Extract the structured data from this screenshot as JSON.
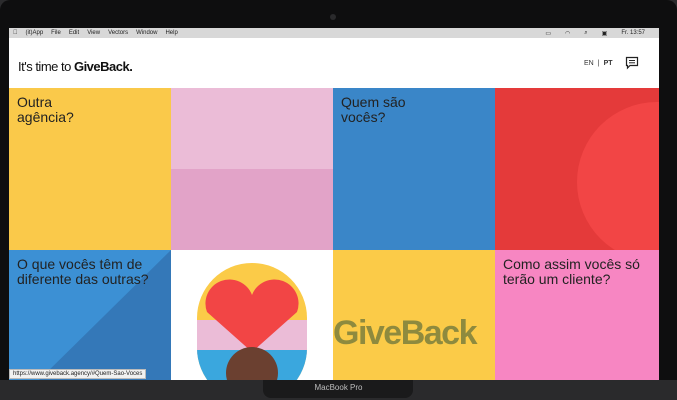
{
  "menubar": {
    "items": [
      "(it)App",
      "File",
      "Edit",
      "View",
      "Vectors",
      "Window",
      "Help"
    ],
    "clock": "Fr. 13:57"
  },
  "header": {
    "brand_prefix": "It's time to ",
    "brand_bold": "GiveBack.",
    "lang_en": "EN",
    "lang_sep": "|",
    "lang_pt": "PT"
  },
  "tiles": {
    "outra": "Outra agência?",
    "quem": "Quem são vocês?",
    "diferente": "O que vocês têm de diferente das outras?",
    "logo": "GiveBack",
    "cliente": "Como assim vocês só terão um cliente?"
  },
  "status_url": "https://www.giveback.agency/#Quem-Sao-Voces",
  "device_label": "MacBook Pro",
  "colors": {
    "yellow": "#fac94a",
    "pink": "#ebbcd7",
    "blue": "#3a86c8",
    "red": "#e43a3a",
    "hotpink": "#f786c2"
  }
}
